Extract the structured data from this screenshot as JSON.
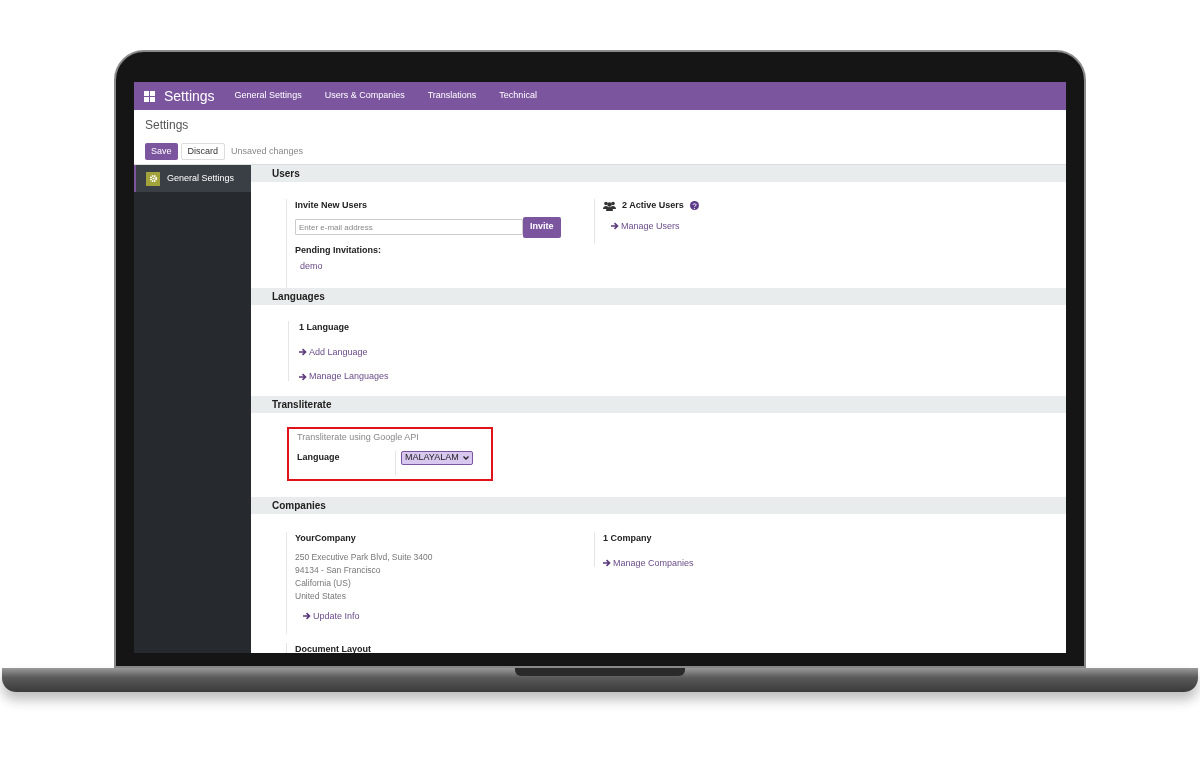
{
  "navbar": {
    "app_title": "Settings",
    "menu": [
      "General Settings",
      "Users & Companies",
      "Translations",
      "Technical"
    ]
  },
  "control_panel": {
    "breadcrumb": "Settings",
    "save": "Save",
    "discard": "Discard",
    "status": "Unsaved changes"
  },
  "sidebar": {
    "items": [
      {
        "label": "General Settings",
        "selected": true
      }
    ]
  },
  "users": {
    "title": "Users",
    "invite_label": "Invite New Users",
    "placeholder": "Enter e-mail address",
    "invite_button": "Invite",
    "pending_label": "Pending Invitations:",
    "pending": [
      "demo"
    ],
    "active_users": "2 Active Users",
    "manage_link": "Manage Users"
  },
  "languages": {
    "title": "Languages",
    "count_label": "1 Language",
    "links": [
      "Add Language",
      "Manage Languages"
    ]
  },
  "transliterate": {
    "title": "Transliterate",
    "highlighted": true,
    "description": "Transliterate using Google API",
    "field_label": "Language",
    "value": "MALAYALAM"
  },
  "companies": {
    "title": "Companies",
    "company_name": "YourCompany",
    "address_lines": [
      "250 Executive Park Blvd, Suite 3400",
      "94134 - San Francisco",
      "California (US)",
      "United States"
    ],
    "update_link": "Update Info",
    "count_label": "1 Company",
    "manage_link": "Manage Companies",
    "document_layout": "Document Layout"
  }
}
